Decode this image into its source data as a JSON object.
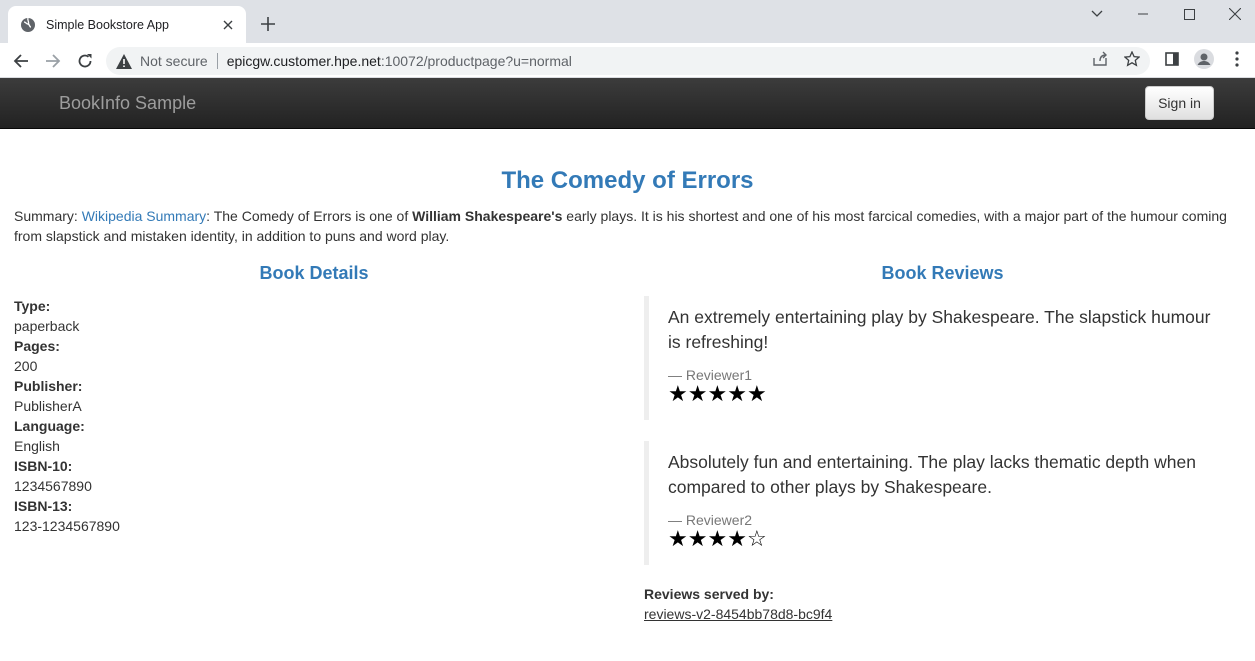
{
  "browser": {
    "tab_title": "Simple Bookstore App",
    "security_label": "Not secure",
    "url_host": "epicgw.customer.hpe.net",
    "url_rest": ":10072/productpage?u=normal"
  },
  "navbar": {
    "brand": "BookInfo Sample",
    "signin_label": "Sign in"
  },
  "book": {
    "title": "The Comedy of Errors",
    "summary_prefix": "Summary: ",
    "summary_link": "Wikipedia Summary",
    "summary_before_bold": ": The Comedy of Errors is one of ",
    "summary_bold": "William Shakespeare's",
    "summary_after_bold": " early plays. It is his shortest and one of his most farcical comedies, with a major part of the humour coming from slapstick and mistaken identity, in addition to puns and word play."
  },
  "details": {
    "heading": "Book Details",
    "fields": [
      {
        "label": "Type:",
        "value": "paperback"
      },
      {
        "label": "Pages:",
        "value": "200"
      },
      {
        "label": "Publisher:",
        "value": "PublisherA"
      },
      {
        "label": "Language:",
        "value": "English"
      },
      {
        "label": "ISBN-10:",
        "value": "1234567890"
      },
      {
        "label": "ISBN-13:",
        "value": "123-1234567890"
      }
    ]
  },
  "reviews": {
    "heading": "Book Reviews",
    "items": [
      {
        "text": "An extremely entertaining play by Shakespeare. The slapstick humour is refreshing!",
        "author": "— Reviewer1",
        "rating": 5,
        "max": 5
      },
      {
        "text": "Absolutely fun and entertaining. The play lacks thematic depth when compared to other plays by Shakespeare.",
        "author": "— Reviewer2",
        "rating": 4,
        "max": 5
      }
    ],
    "served_label": "Reviews served by:",
    "served_value": "reviews-v2-8454bb78d8-bc9f4"
  }
}
